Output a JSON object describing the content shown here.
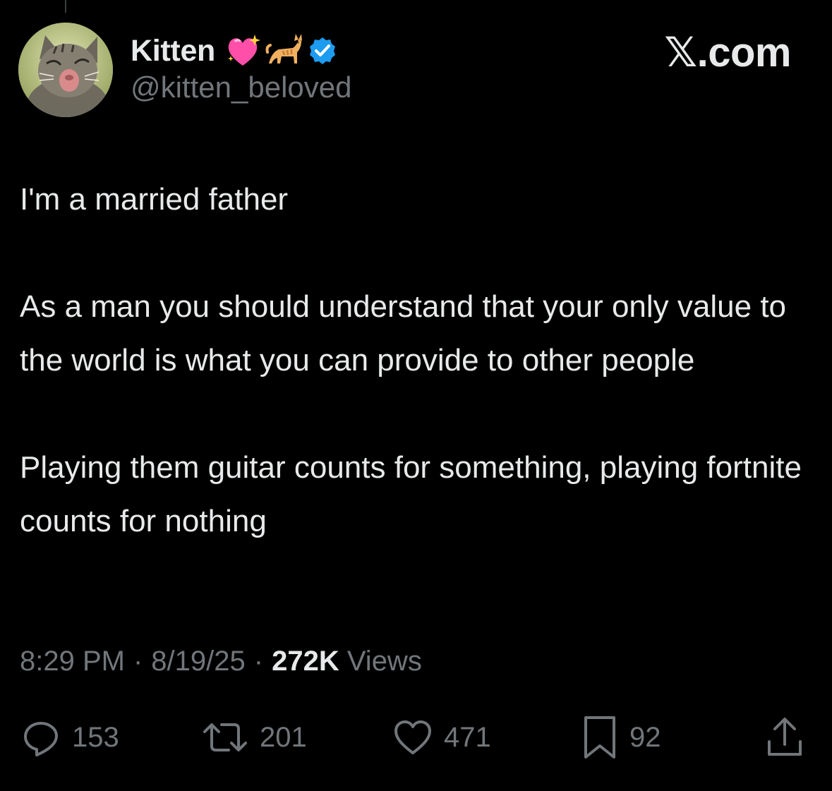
{
  "author": {
    "display_name": "Kitten",
    "handle": "@kitten_beloved",
    "emojis": [
      "sparkling-heart",
      "cat"
    ],
    "verified": true,
    "verified_color": "#1d9bf0"
  },
  "brand": "𝕏.com",
  "tweet": {
    "paragraphs": [
      "I'm a married father",
      "As a man you should understand that your only value to the world is what you can provide to other people",
      "Playing them guitar counts for something, playing fortnite counts for nothing"
    ]
  },
  "meta": {
    "time": "8:29 PM",
    "date": "8/19/25",
    "views_count": "272K",
    "views_label": "Views"
  },
  "actions": {
    "replies": "153",
    "reposts": "201",
    "likes": "471",
    "bookmarks": "92"
  },
  "colors": {
    "background": "#000000",
    "primary_text": "#e7e9ea",
    "secondary_text": "#71767b"
  }
}
